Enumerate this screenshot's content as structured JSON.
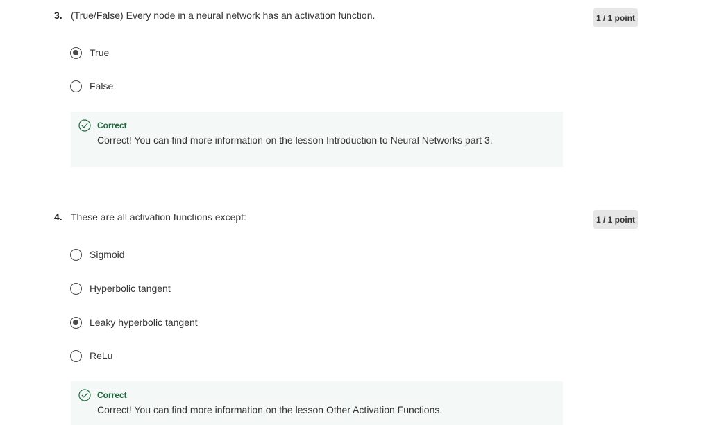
{
  "questions": [
    {
      "number": "3.",
      "text": "(True/False) Every node in a neural network has an activation function.",
      "points": "1 / 1 point",
      "options": [
        {
          "label": "True",
          "selected": true
        },
        {
          "label": "False",
          "selected": false
        }
      ],
      "feedback": {
        "title": "Correct",
        "message": "Correct! You can find more information on the lesson Introduction to Neural Networks part 3."
      }
    },
    {
      "number": "4.",
      "text": "These are all activation functions except:",
      "points": "1 / 1 point",
      "options": [
        {
          "label": "Sigmoid",
          "selected": false
        },
        {
          "label": "Hyperbolic tangent",
          "selected": false
        },
        {
          "label": "Leaky hyperbolic tangent",
          "selected": true
        },
        {
          "label": "ReLu",
          "selected": false
        }
      ],
      "feedback": {
        "title": "Correct",
        "message": "Correct! You can find more information on the lesson Other Activation Functions."
      }
    }
  ],
  "colors": {
    "feedback_bg": "#f4f8f7",
    "correct_green": "#1f6a3d",
    "badge_bg": "#e6e6e6"
  },
  "icons": {
    "feedback": "check-circle-icon",
    "option": "radio-button"
  }
}
